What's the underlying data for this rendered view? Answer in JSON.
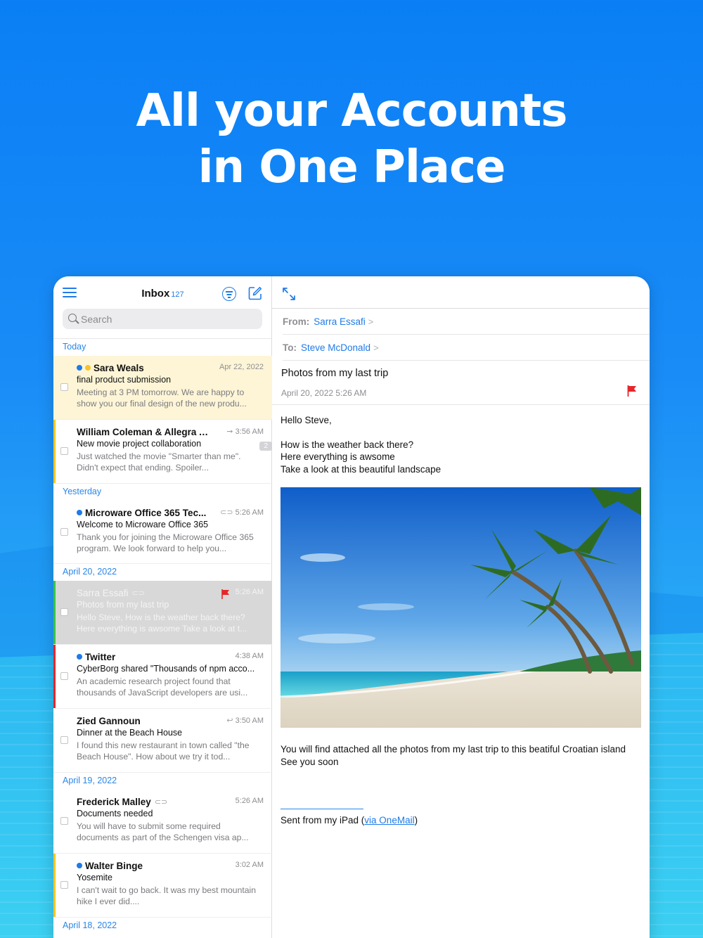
{
  "headline": {
    "line1": "All your Accounts",
    "line2": "in One Place"
  },
  "list": {
    "title": "Inbox",
    "count": "127",
    "search_placeholder": "Search",
    "sections": {
      "today": "Today",
      "yesterday": "Yesterday",
      "apr20": "April 20, 2022",
      "apr19": "April 19, 2022",
      "apr18": "April 18, 2022"
    },
    "mails": [
      {
        "sender": "Sara Weals",
        "date": "Apr 22, 2022",
        "subject": "final product submission",
        "preview": "Meeting at 3 PM tomorrow. We are happy to show you our final design of the new produ..."
      },
      {
        "sender": "William Coleman & Allegra As...",
        "date": "3:56 AM",
        "subject": "New movie project collaboration",
        "preview": "Just watched the movie \"Smarter than me\". Didn't expect that ending. Spoiler...",
        "badge": "2"
      },
      {
        "sender": "Microware Office 365 Tec...",
        "date": "5:26 AM",
        "subject": "Welcome to Microware Office 365",
        "preview": "Thank you for joining the Microware Office 365 program. We look forward to help you..."
      },
      {
        "sender": "Sarra Essafi",
        "date": "5:26 AM",
        "subject": "Photos from my last trip",
        "preview": "Hello Steve, How is the weather back there? Here everything is awsome Take a look at t..."
      },
      {
        "sender": "Twitter",
        "date": "4:38 AM",
        "subject": "CyberBorg shared \"Thousands of npm acco...",
        "preview": "An academic research project found that thousands of JavaScript developers are usi..."
      },
      {
        "sender": "Zied Gannoun",
        "date": "3:50 AM",
        "subject": "Dinner at the Beach House",
        "preview": "I found this new restaurant in town called \"the Beach House\". How about we try it tod..."
      },
      {
        "sender": "Frederick Malley",
        "date": "5:26 AM",
        "subject": "Documents needed",
        "preview": "You will have to submit some required documents as part of the Schengen visa ap..."
      },
      {
        "sender": "Walter Binge",
        "date": "3:02 AM",
        "subject": "Yosemite",
        "preview": "I can't wait to go back. It was my best mountain hike I ever did...."
      }
    ]
  },
  "detail": {
    "from_label": "From:",
    "from_value": "Sarra Essafi",
    "to_label": "To:",
    "to_value": "Steve McDonald",
    "chevron": ">",
    "subject": "Photos from my last trip",
    "date": "April 20, 2022 5:26 AM",
    "body": {
      "greeting": "Hello Steve,",
      "line1": "How is the weather back there?",
      "line2": "Here everything is awsome",
      "line3": "Take a look at this beautiful landscape",
      "line4": "You will find attached all the photos from my last trip to this beatiful Croatian island",
      "line5": "See you soon"
    },
    "signature_prefix": "Sent from my iPad (",
    "signature_link": "via OneMail",
    "signature_suffix": ")"
  },
  "colors": {
    "accent": "#1e7be8",
    "flag": "#e5262a",
    "bar_yellow": "#f5c527",
    "bar_green": "#39c24a",
    "bar_red": "#e5262a",
    "dot_blue": "#1e7be8",
    "dot_yellow": "#f5c527"
  },
  "icons": [
    "menu-icon",
    "filter-icon",
    "compose-icon",
    "search-icon",
    "expand-icon",
    "flag-icon",
    "forward-icon",
    "reply-icon",
    "attachment-icon"
  ]
}
